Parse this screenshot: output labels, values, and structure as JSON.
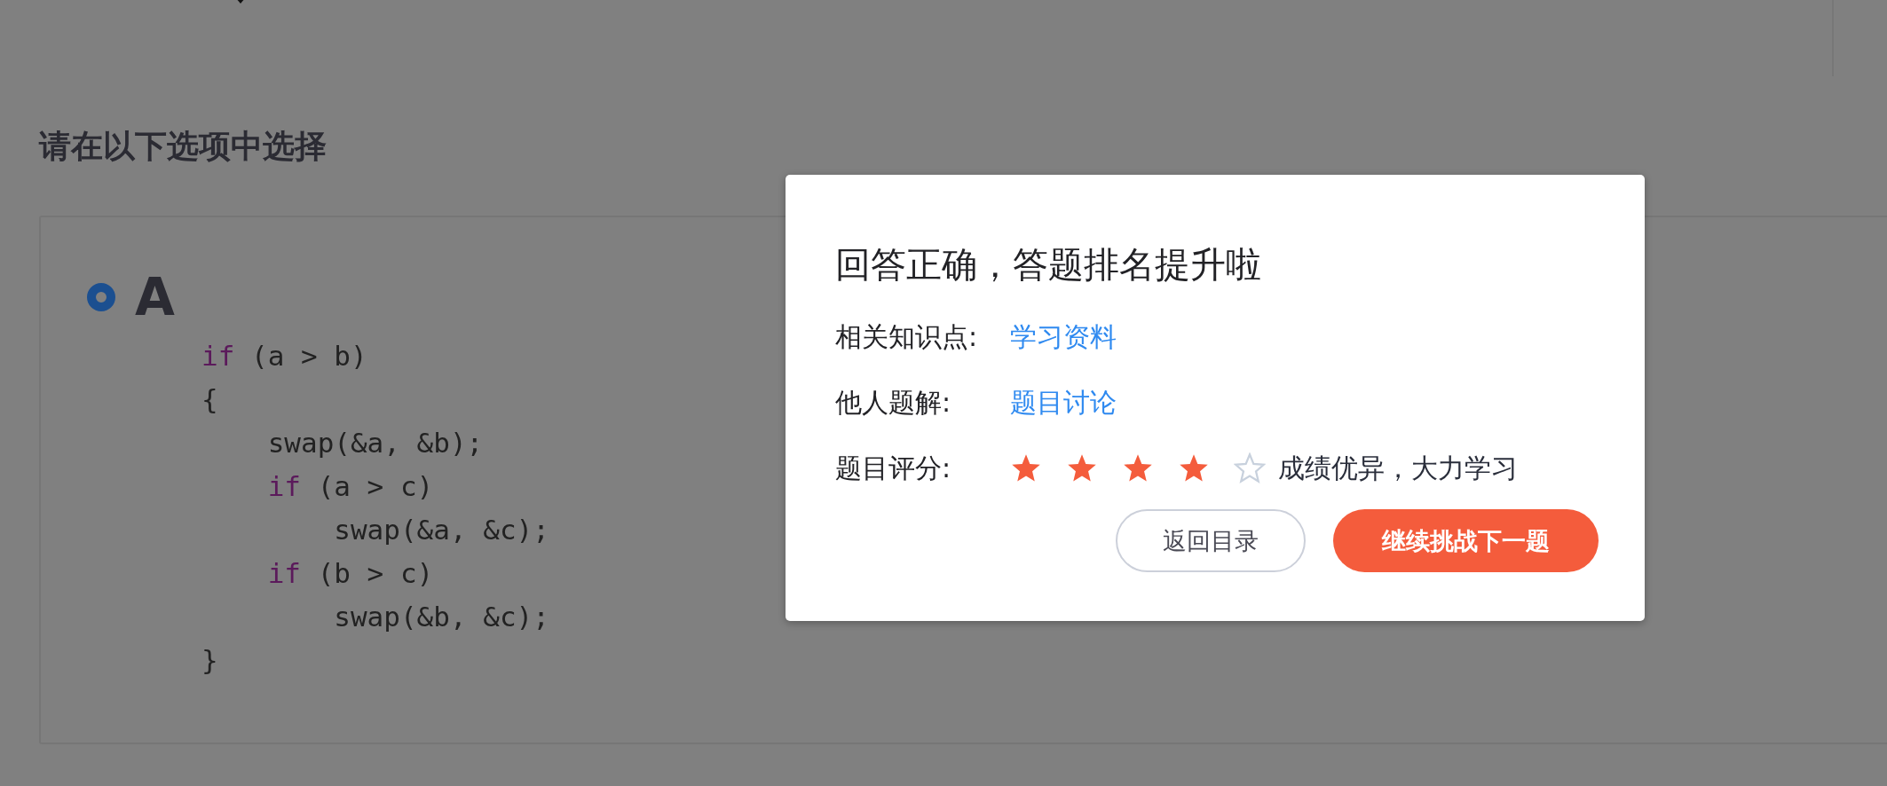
{
  "page": {
    "heading": "请在以下选项中选择"
  },
  "options": [
    {
      "label": "A",
      "selected": true,
      "code": [
        {
          "tokens": [
            {
              "text": "if",
              "kind": "keyword"
            },
            {
              "text": " (a > b)",
              "kind": "plain"
            }
          ]
        },
        {
          "tokens": [
            {
              "text": "{",
              "kind": "plain"
            }
          ],
          "children": [
            {
              "tokens": [
                {
                  "text": "swap(&a, &b);",
                  "kind": "plain"
                }
              ]
            },
            {
              "tokens": [
                {
                  "text": "if",
                  "kind": "keyword"
                },
                {
                  "text": " (a > c)",
                  "kind": "plain"
                }
              ],
              "children": [
                {
                  "tokens": [
                    {
                      "text": "swap(&a, &c);",
                      "kind": "plain"
                    }
                  ]
                }
              ]
            },
            {
              "tokens": [
                {
                  "text": "if",
                  "kind": "keyword"
                },
                {
                  "text": " (b > c)",
                  "kind": "plain"
                }
              ],
              "children": [
                {
                  "tokens": [
                    {
                      "text": "swap(&b, &c);",
                      "kind": "plain"
                    }
                  ]
                }
              ]
            }
          ]
        },
        {
          "tokens": [
            {
              "text": "}",
              "kind": "plain"
            }
          ]
        }
      ]
    }
  ],
  "dialog": {
    "title": "回答正确，答题排名提升啦",
    "rows": [
      {
        "kind": "link",
        "label": "相关知识点:",
        "link": "学习资料"
      },
      {
        "kind": "link",
        "label": "他人题解:",
        "link": "题目讨论"
      },
      {
        "kind": "rating",
        "label": "题目评分:",
        "stars": 4,
        "comment": "成绩优异，大力学习"
      }
    ],
    "buttons": [
      {
        "label": "返回目录",
        "kind": "secondary"
      },
      {
        "label": "继续挑战下一题",
        "kind": "primary"
      }
    ]
  }
}
